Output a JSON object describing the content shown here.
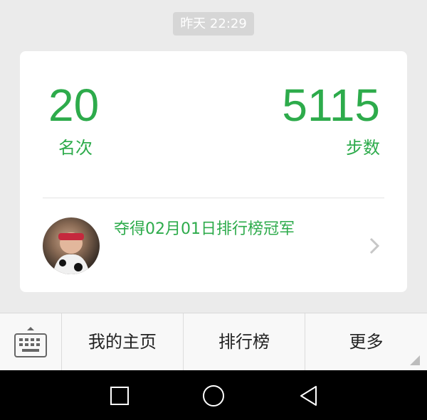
{
  "timestamp": "昨天 22:29",
  "card": {
    "rank_value": "20",
    "rank_label": "名次",
    "steps_value": "5115",
    "steps_label": "步数",
    "champion_text": "夺得02月01日排行榜冠军"
  },
  "bottom_menu": {
    "items": [
      {
        "label": "我的主页"
      },
      {
        "label": "排行榜"
      },
      {
        "label": "更多"
      }
    ]
  },
  "colors": {
    "accent": "#2dab4b",
    "background": "#ebebeb"
  },
  "icons": [
    "keyboard-icon",
    "chevron-right-icon",
    "nav-back-icon",
    "nav-home-icon",
    "nav-recents-icon"
  ]
}
